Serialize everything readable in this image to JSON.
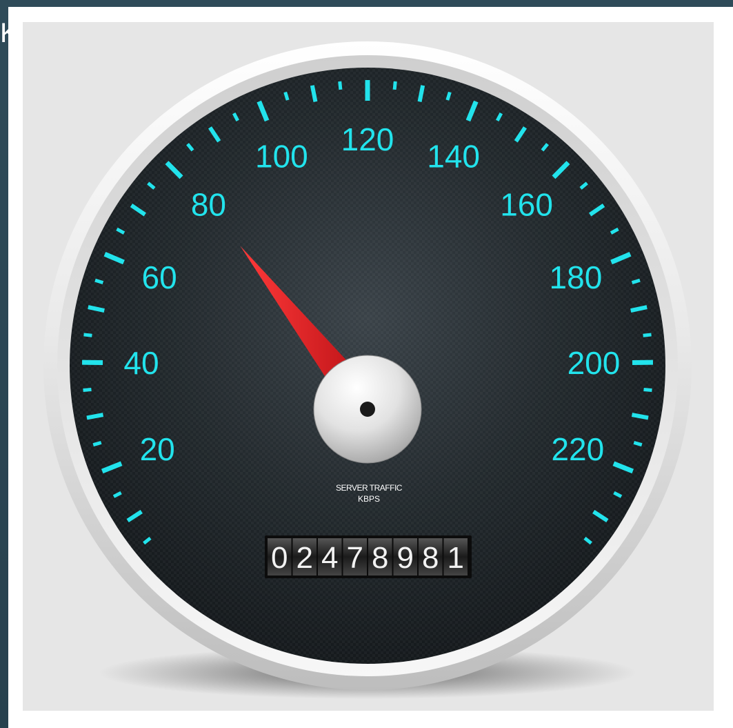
{
  "edge_glyph": "K",
  "gauge": {
    "unit_line1": "SERVER TRAFFIC",
    "unit_line2": "KBPS",
    "scale_min": 0,
    "scale_max": 240,
    "major_labels": [
      "20",
      "40",
      "60",
      "80",
      "100",
      "120",
      "140",
      "160",
      "180",
      "200",
      "220"
    ],
    "needle_value": 86,
    "odometer_digits": [
      "0",
      "2",
      "4",
      "7",
      "8",
      "9",
      "8",
      "1"
    ],
    "colors": {
      "accent": "#22e3ec",
      "needle": "#e8161d",
      "dial": "#1e2428",
      "bezel": "#f2f2f2"
    }
  }
}
